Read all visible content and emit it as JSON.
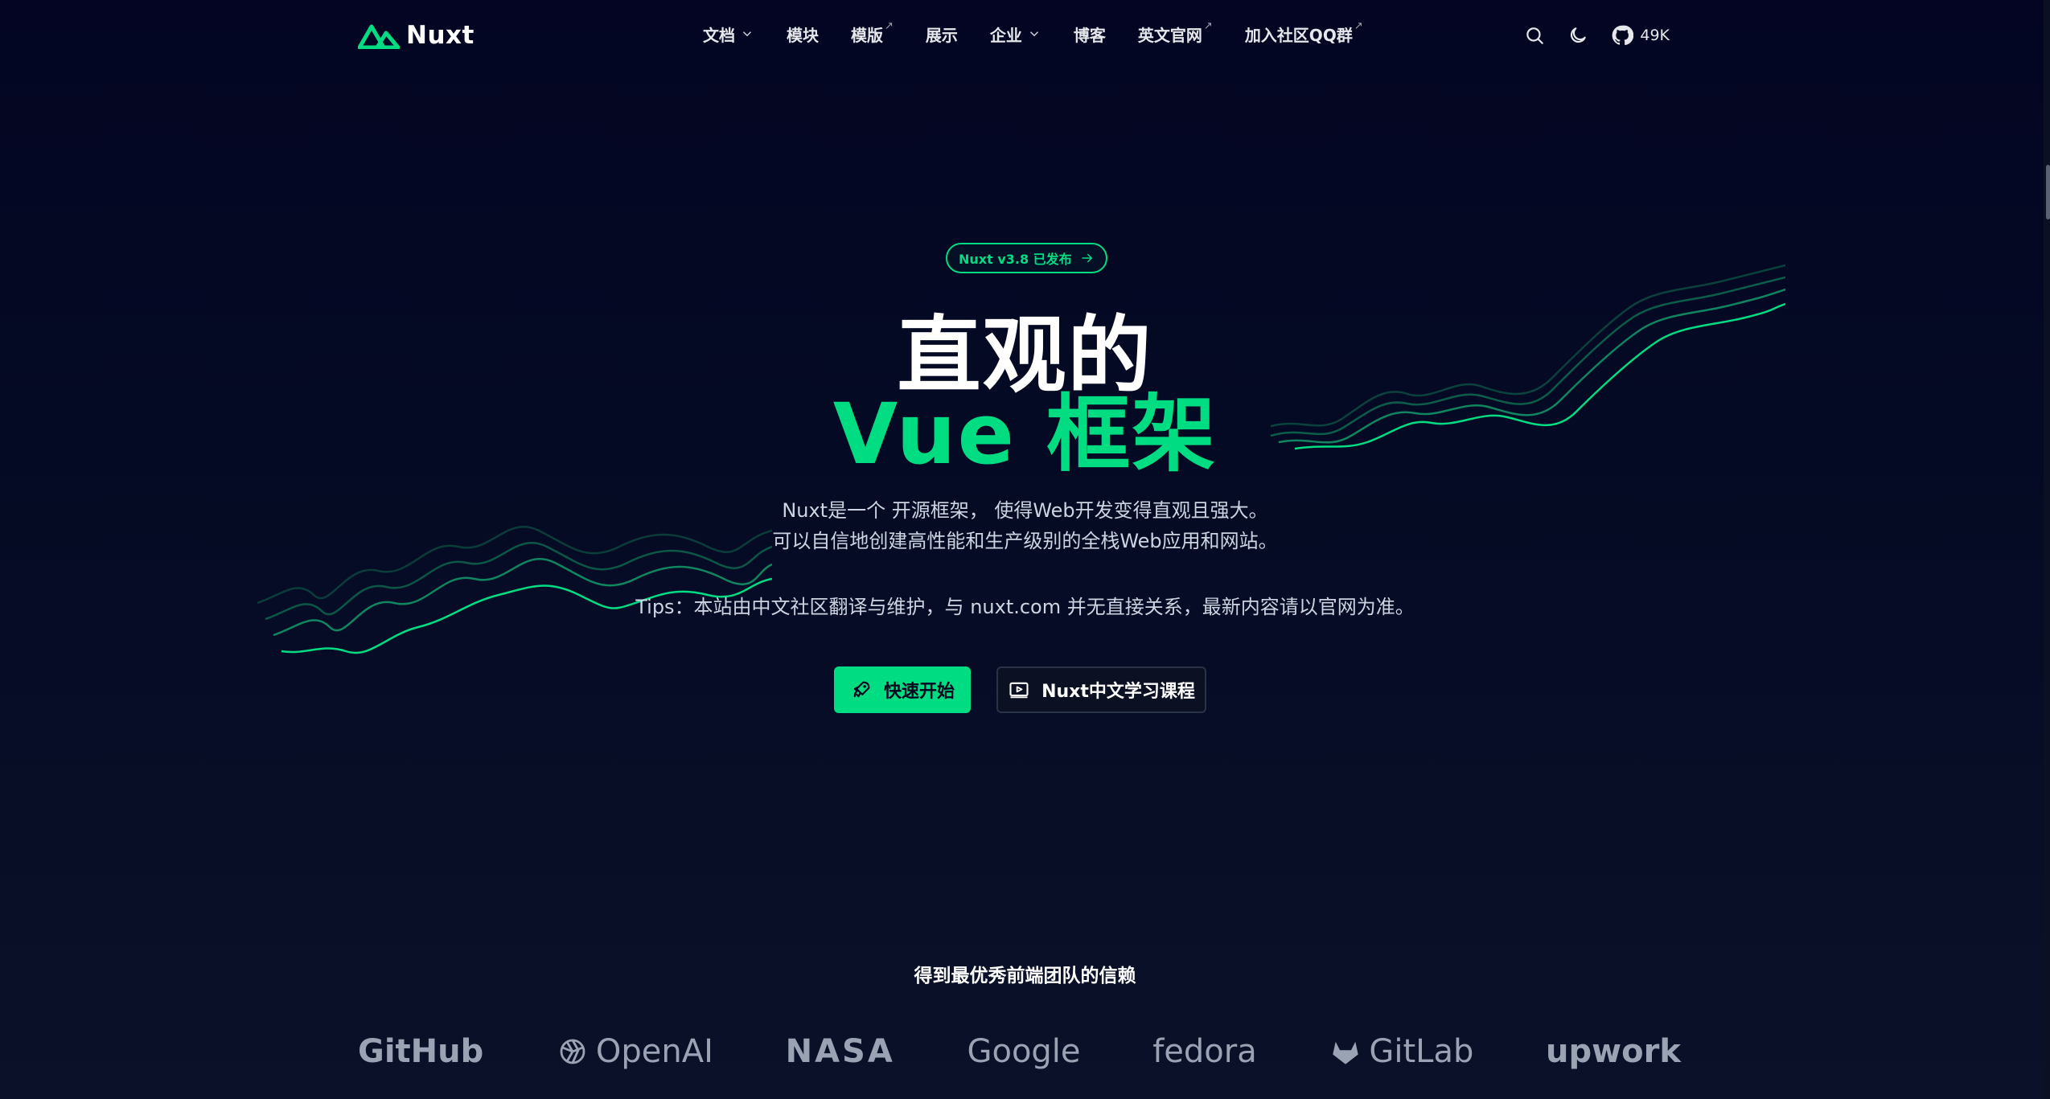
{
  "header": {
    "logo_text": "Nuxt",
    "nav": [
      {
        "label": "文档",
        "dropdown": true,
        "external": false
      },
      {
        "label": "模块",
        "dropdown": false,
        "external": false
      },
      {
        "label": "模版",
        "dropdown": false,
        "external": true
      },
      {
        "label": "展示",
        "dropdown": false,
        "external": false
      },
      {
        "label": "企业",
        "dropdown": true,
        "external": false
      },
      {
        "label": "博客",
        "dropdown": false,
        "external": false
      },
      {
        "label": "英文官网",
        "dropdown": false,
        "external": true
      },
      {
        "label": "加入社区QQ群",
        "dropdown": false,
        "external": true
      }
    ],
    "external_mark": "↗",
    "github_stars": "49K",
    "icons": [
      "search-icon",
      "moon-icon",
      "github-icon"
    ]
  },
  "hero": {
    "badge": "Nuxt v3.8 已发布",
    "title_line1": "直观的",
    "title_line2": "Vue 框架",
    "description_line1": "Nuxt是一个 开源框架， 使得Web开发变得直观且强大。",
    "description_line2": "可以自信地创建高性能和生产级别的全栈Web应用和网站。",
    "tips": "Tips：本站由中文社区翻译与维护，与 nuxt.com 并无直接关系，最新内容请以官网为准。",
    "primary_button": "快速开始",
    "secondary_button": "Nuxt中文学习课程"
  },
  "trusted": {
    "heading": "得到最优秀前端团队的信赖",
    "brands": [
      "GitHub",
      "OpenAI",
      "NASA",
      "Google",
      "fedora",
      "GitLab",
      "upwork"
    ]
  },
  "colors": {
    "background": "#020420",
    "accent": "#00dc82",
    "muted_logo": "#9aa3b4"
  }
}
